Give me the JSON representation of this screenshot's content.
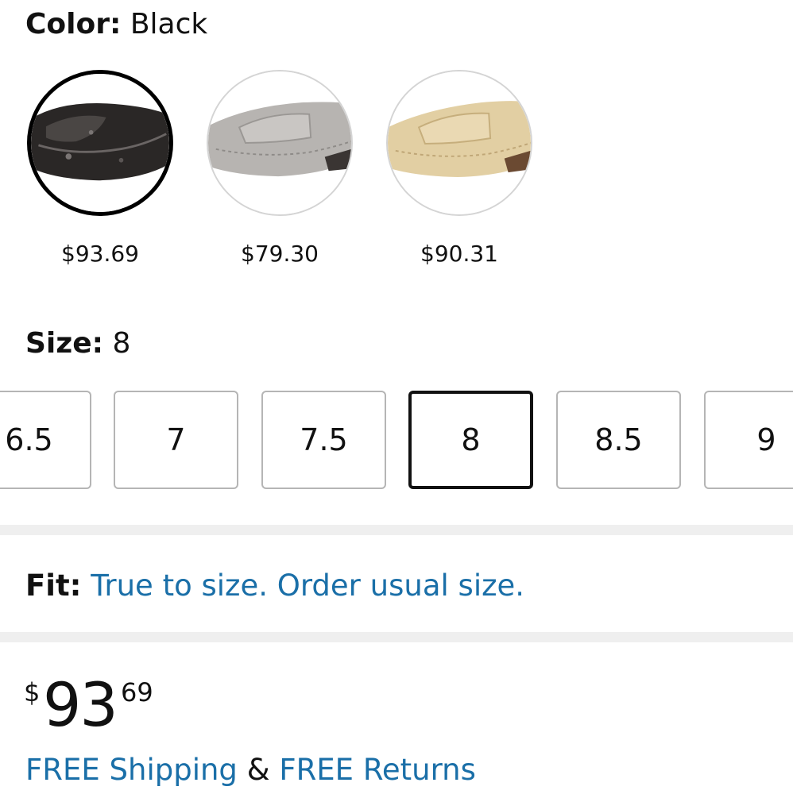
{
  "color": {
    "label": "Color:",
    "value": "Black",
    "swatches": [
      {
        "name": "Black",
        "price": "$93.69",
        "selected": true,
        "tone": "#2a2726"
      },
      {
        "name": "Silver",
        "price": "$79.30",
        "selected": false,
        "tone": "#b7b4b1"
      },
      {
        "name": "Gold",
        "price": "$90.31",
        "selected": false,
        "tone": "#e2cfa3"
      }
    ]
  },
  "size": {
    "label": "Size:",
    "value": "8",
    "options": [
      "6.5",
      "7",
      "7.5",
      "8",
      "8.5",
      "9"
    ],
    "selected": "8"
  },
  "fit": {
    "label": "Fit:",
    "text": "True to size. Order usual size."
  },
  "price": {
    "symbol": "$",
    "whole": "93",
    "fraction": "69"
  },
  "shipping": {
    "free_shipping": "FREE Shipping",
    "ampersand": "&",
    "free_returns": "FREE Returns"
  },
  "colors": {
    "link": "#1a6fa8",
    "divider": "#efefef",
    "selected_border": "#111111"
  }
}
